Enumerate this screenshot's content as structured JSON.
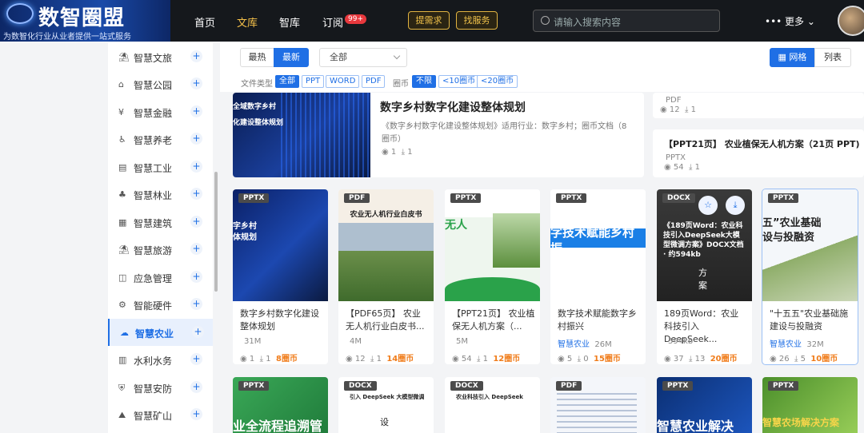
{
  "header": {
    "logo_title": "数智圈盟",
    "logo_sub": "为数智化行业从业者提供一站式服务",
    "nav": [
      "首页",
      "文库",
      "智库",
      "订阅"
    ],
    "sub_badge": "99+",
    "btn_need": "提需求",
    "btn_service": "找服务",
    "search_placeholder": "请输入搜索内容",
    "more": "••• 更多 ⌄"
  },
  "sidebar": [
    {
      "icon": "⛱",
      "label": "智慧文旅"
    },
    {
      "icon": "⌂",
      "label": "智慧公园"
    },
    {
      "icon": "¥",
      "label": "智慧金融"
    },
    {
      "icon": "♿",
      "label": "智慧养老"
    },
    {
      "icon": "▤",
      "label": "智慧工业"
    },
    {
      "icon": "♣",
      "label": "智慧林业"
    },
    {
      "icon": "▦",
      "label": "智慧建筑"
    },
    {
      "icon": "⛱",
      "label": "智慧旅游"
    },
    {
      "icon": "◫",
      "label": "应急管理"
    },
    {
      "icon": "⚙",
      "label": "智能硬件"
    },
    {
      "icon": "☁",
      "label": "智慧农业"
    },
    {
      "icon": "▥",
      "label": "水利水务"
    },
    {
      "icon": "⛨",
      "label": "智慧安防"
    },
    {
      "icon": "⛰",
      "label": "智慧矿山"
    }
  ],
  "filters": {
    "sort": [
      "最热",
      "最新"
    ],
    "category": "全部",
    "view": [
      "▦ 网格",
      "列表"
    ],
    "type_label": "文件类型",
    "types": [
      "全部",
      "PPT",
      "WORD",
      "PDF"
    ],
    "coin_label": "圈币",
    "coins": [
      "不限",
      "<10圈币",
      "<20圈币"
    ]
  },
  "featured": {
    "title": "数字乡村数字化建设整体规划",
    "desc": "《数字乡村数字化建设整体规划》适用行业：数字乡村；圈币文档（8圈币）",
    "views": "1",
    "downloads": "1",
    "img_text1": "全域数字乡村",
    "img_text2": "化建设整体规划"
  },
  "right_cards": [
    {
      "format": "PDF",
      "views": "12",
      "downloads": "1"
    },
    {
      "title": "【PPT21页】 农业植保无人机方案（21页 PPT)",
      "format": "PPTX",
      "views": "54",
      "downloads": "1"
    }
  ],
  "grid": [
    {
      "format": "PPTX",
      "title": "数字乡村数字化建设整体规划",
      "size": "31M",
      "views": "1",
      "downloads": "1",
      "coins": "8圈币",
      "img_text": "字乡村\n体规划"
    },
    {
      "format": "PDF",
      "title": "【PDF65页】 农业无人机行业白皮书...",
      "size": "4M",
      "views": "12",
      "downloads": "1",
      "coins": "14圈币",
      "img_text": "农业无人机行业白皮书"
    },
    {
      "format": "PPTX",
      "title": "【PPT21页】 农业植保无人机方案（...",
      "size": "5M",
      "views": "54",
      "downloads": "1",
      "coins": "12圈币",
      "img_text": "无人"
    },
    {
      "format": "PPTX",
      "title": "数字技术赋能数字乡村振兴",
      "tag": "智慧农业",
      "size": "26M",
      "views": "5",
      "downloads": "0",
      "coins": "15圈币",
      "img_text": "字技术赋能乡村振"
    },
    {
      "format": "DOCX",
      "title": "189页Word：农业科技引入DeepSeek...",
      "size": "594kb",
      "views": "37",
      "downloads": "13",
      "coins": "20圈币",
      "img_text": "《189页Word：农业科技引入DeepSeek大模型微调方案》DOCX文档 · 约594kb",
      "img_sub": "方\n案"
    },
    {
      "format": "PPTX",
      "title": "\"十五五\"农业基础施建设与投融资",
      "tag": "智慧农业",
      "size": "32M",
      "views": "26",
      "downloads": "5",
      "coins": "10圈币",
      "img_text": "五”农业基础\n设与投融资"
    }
  ],
  "row3": [
    {
      "format": "PPTX",
      "img_text": "业全流程追溯管"
    },
    {
      "format": "DOCX",
      "img_text": "引入 DeepSeek 大模型微调",
      "img_sub": "设"
    },
    {
      "format": "DOCX",
      "img_text": "农业科技引入 DeepSeek"
    },
    {
      "format": "PDF",
      "img_text": ""
    },
    {
      "format": "PPTX",
      "img_text": "智慧农业解决"
    },
    {
      "format": "PPTX",
      "img_text": "智慧农场解决方案"
    }
  ],
  "colors": {
    "accent": "#1f6fe5",
    "coin": "#f07c1a",
    "nav_active": "#f7c24a"
  }
}
